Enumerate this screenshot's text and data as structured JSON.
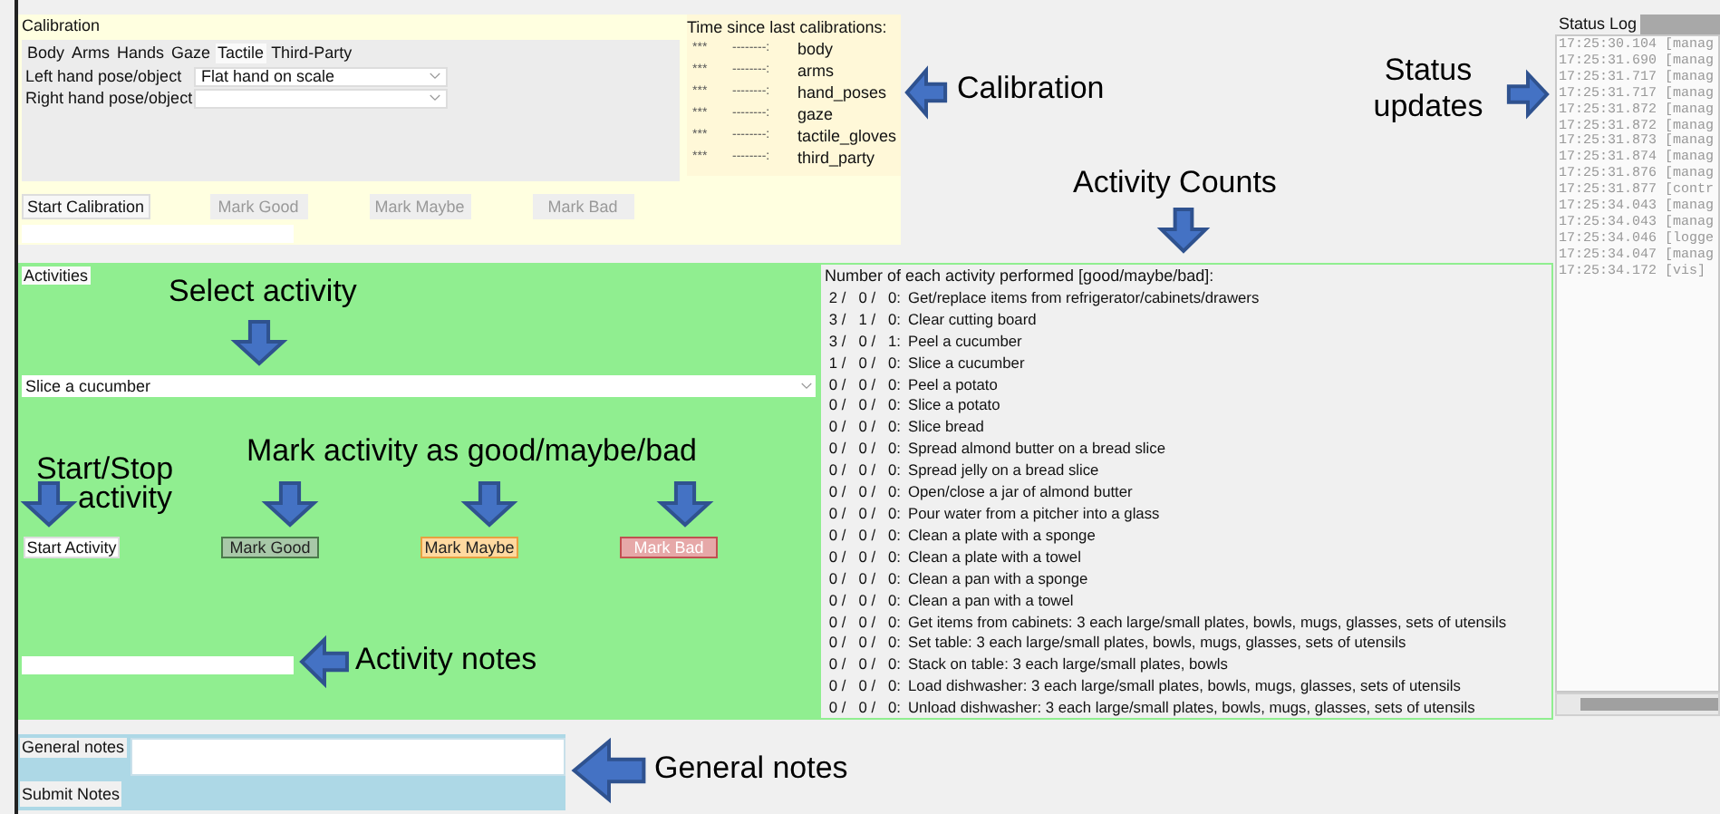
{
  "calibration": {
    "title": "Calibration",
    "tabs": [
      {
        "label": "Body",
        "selected": false
      },
      {
        "label": "Arms",
        "selected": false
      },
      {
        "label": "Hands",
        "selected": false
      },
      {
        "label": "Gaze",
        "selected": false
      },
      {
        "label": "Tactile",
        "selected": true
      },
      {
        "label": "Third-Party",
        "selected": false
      }
    ],
    "fields": [
      {
        "label": "Left hand pose/object",
        "value": "Flat hand on scale"
      },
      {
        "label": "Right hand pose/object"
      }
    ],
    "times_title": "Time since last calibrations:",
    "times": [
      {
        "mask": "***",
        "time": "--------:",
        "name": "body"
      },
      {
        "mask": "***",
        "time": "--------:",
        "name": "arms"
      },
      {
        "mask": "***",
        "time": "--------:",
        "name": "hand_poses"
      },
      {
        "mask": "***",
        "time": "--------:",
        "name": "gaze"
      },
      {
        "mask": "***",
        "time": "--------:",
        "name": "tactile_gloves"
      },
      {
        "mask": "***",
        "time": "--------:",
        "name": "third_party"
      }
    ],
    "buttons": [
      {
        "label": "Start Calibration",
        "disabled": false
      },
      {
        "label": "Mark Good",
        "disabled": true
      },
      {
        "label": "Mark Maybe",
        "disabled": true
      },
      {
        "label": "Mark Bad",
        "disabled": true
      }
    ]
  },
  "activities": {
    "title": "Activities",
    "selected_activity": "Slice a cucumber",
    "buttons": [
      {
        "label": "Start Activity",
        "kind": "start"
      },
      {
        "label": "Mark Good",
        "kind": "good"
      },
      {
        "label": "Mark Maybe",
        "kind": "maybe"
      },
      {
        "label": "Mark Bad",
        "kind": "bad"
      }
    ]
  },
  "counts": {
    "title": "Number of each activity performed [good/maybe/bad]:",
    "rows": [
      {
        "counts": "2 /   0 /   0:",
        "activity": "Get/replace items from refrigerator/cabinets/drawers"
      },
      {
        "counts": "3 /   1 /   0:",
        "activity": "Clear cutting board"
      },
      {
        "counts": "3 /   0 /   1:",
        "activity": "Peel a cucumber"
      },
      {
        "counts": "1 /   0 /   0:",
        "activity": "Slice a cucumber"
      },
      {
        "counts": "0 /   0 /   0:",
        "activity": "Peel a potato"
      },
      {
        "counts": "0 /   0 /   0:",
        "activity": "Slice a potato"
      },
      {
        "counts": "0 /   0 /   0:",
        "activity": "Slice bread"
      },
      {
        "counts": "0 /   0 /   0:",
        "activity": "Spread almond butter on a bread slice"
      },
      {
        "counts": "0 /   0 /   0:",
        "activity": "Spread jelly on a bread slice"
      },
      {
        "counts": "0 /   0 /   0:",
        "activity": "Open/close a jar of almond butter"
      },
      {
        "counts": "0 /   0 /   0:",
        "activity": "Pour water from a pitcher into a glass"
      },
      {
        "counts": "0 /   0 /   0:",
        "activity": "Clean a plate with a sponge"
      },
      {
        "counts": "0 /   0 /   0:",
        "activity": "Clean a plate with a towel"
      },
      {
        "counts": "0 /   0 /   0:",
        "activity": "Clean a pan with a sponge"
      },
      {
        "counts": "0 /   0 /   0:",
        "activity": "Clean a pan with a towel"
      },
      {
        "counts": "0 /   0 /   0:",
        "activity": "Get items from cabinets: 3 each large/small plates, bowls, mugs, glasses, sets of utensils"
      },
      {
        "counts": "0 /   0 /   0:",
        "activity": "Set table: 3 each large/small plates, bowls, mugs, glasses, sets of utensils"
      },
      {
        "counts": "0 /   0 /   0:",
        "activity": "Stack on table: 3 each large/small plates, bowls"
      },
      {
        "counts": "0 /   0 /   0:",
        "activity": "Load dishwasher: 3 each large/small plates, bowls, mugs, glasses, sets of utensils"
      },
      {
        "counts": "0 /   0 /   0:",
        "activity": "Unload dishwasher: 3 each large/small plates, bowls, mugs, glasses, sets of utensils"
      }
    ]
  },
  "status_log": {
    "title": "Status Log",
    "lines": [
      "17:25:30.104 [manag",
      "17:25:31.690 [manag",
      "17:25:31.717 [manag",
      "17:25:31.717 [manag",
      "17:25:31.872 [manag",
      "17:25:31.872 [manag",
      "17:25:31.873 [manag",
      "17:25:31.874 [manag",
      "17:25:31.876 [manag",
      "17:25:31.877 [contr",
      "17:25:34.043 [manag",
      "17:25:34.043 [manag",
      "17:25:34.046 [logge",
      "17:25:34.047 [manag",
      "17:25:34.172 [vis]"
    ]
  },
  "general_notes": {
    "label": "General notes",
    "button": "Submit Notes"
  },
  "annotations": [
    {
      "text": "Calibration"
    },
    {
      "text": "Status updates"
    },
    {
      "text": "Activity Counts"
    },
    {
      "text": "Select activity"
    },
    {
      "text": "Start/Stop"
    },
    {
      "text": "activity"
    },
    {
      "text": "Mark activity as good/maybe/bad"
    },
    {
      "text": "Activity notes"
    },
    {
      "text": "General notes"
    }
  ],
  "annotation_arrows": [
    {
      "kind": "left"
    },
    {
      "kind": "right"
    },
    {
      "kind": "down"
    },
    {
      "kind": "down"
    },
    {
      "kind": "down"
    },
    {
      "kind": "down"
    },
    {
      "kind": "down"
    },
    {
      "kind": "down"
    },
    {
      "kind": "left"
    },
    {
      "kind": "left"
    }
  ]
}
